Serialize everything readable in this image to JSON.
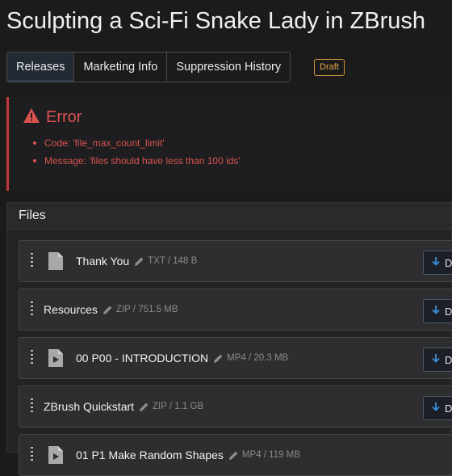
{
  "page": {
    "title": "Sculpting a Sci-Fi Snake Lady in ZBrush"
  },
  "tabs": [
    {
      "label": "Releases",
      "active": true
    },
    {
      "label": "Marketing Info",
      "active": false
    },
    {
      "label": "Suppression History",
      "active": false
    }
  ],
  "status_badge": "Draft",
  "error": {
    "title": "Error",
    "items": [
      "Code: 'file_max_count_limit'",
      "Message: 'files should have less than 100 ids'"
    ]
  },
  "files": {
    "header": "Files",
    "download_label": "D",
    "items": [
      {
        "name": "Thank You",
        "meta": "TXT / 148 B",
        "icon": "text-file-icon"
      },
      {
        "name": "Resources",
        "meta": "ZIP / 751.5 MB",
        "icon": ""
      },
      {
        "name": "00 P00 - INTRODUCTION",
        "meta": "MP4 / 20.3 MB",
        "icon": "video-file-icon"
      },
      {
        "name": "ZBrush Quickstart",
        "meta": "ZIP / 1.1 GB",
        "icon": ""
      },
      {
        "name": "01 P1 Make Random Shapes",
        "meta": "MP4 / 119 MB",
        "icon": "video-file-icon"
      }
    ]
  },
  "colors": {
    "error": "#d9534f",
    "badge": "#e0a84a",
    "accent": "#3b8fd9"
  }
}
